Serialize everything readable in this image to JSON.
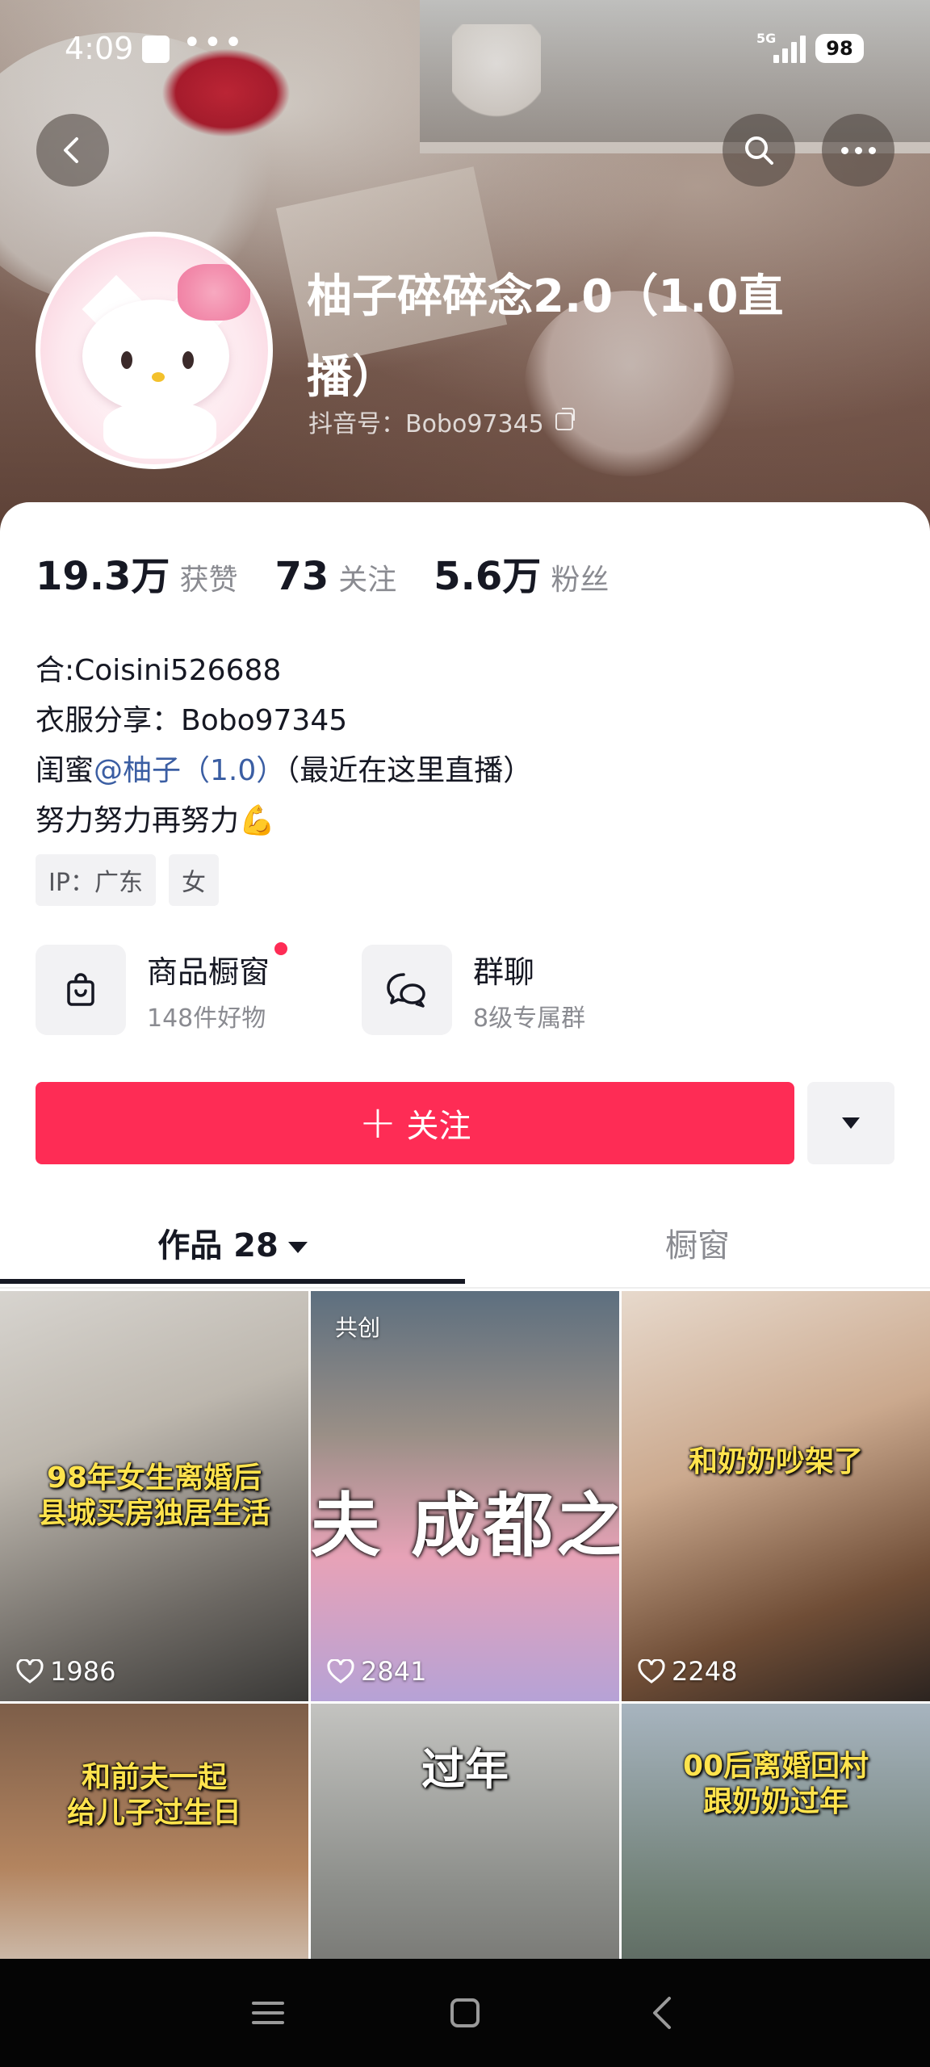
{
  "status_bar": {
    "time": "4:09",
    "dots": "•••",
    "network": "5G",
    "battery": "98"
  },
  "profile": {
    "name_line1": "柚子碎碎念2.0（1.0直",
    "name_line2": "播）",
    "douyin_id": "抖音号：Bobo97345"
  },
  "stats": [
    {
      "value": "19.3万",
      "label": "获赞"
    },
    {
      "value": "73",
      "label": "关注"
    },
    {
      "value": "5.6万",
      "label": "粉丝"
    }
  ],
  "bio": {
    "line1": "合:Coisini526688",
    "line2": "衣服分享：Bobo97345",
    "line3_prefix": "闺蜜",
    "line3_mention": "@柚子（1.0）",
    "line3_suffix": "（最近在这里直播）",
    "line4": "努力努力再努力",
    "line4_emoji": "💪"
  },
  "tags": [
    "IP：广东",
    "女"
  ],
  "entries": {
    "shop_title": "商品橱窗",
    "shop_sub": "148件好物",
    "group_title": "群聊",
    "group_sub": "8级专属群"
  },
  "actions": {
    "follow_label": "关注",
    "follow_plus": "+"
  },
  "tabs": {
    "works": "作品 28",
    "window": "橱窗"
  },
  "videos": [
    {
      "caption": "98年女生离婚后\n县城买房独居生活",
      "likes": "1986"
    },
    {
      "caption": "",
      "big_text": "夫 成都之",
      "co_tag": "共创",
      "likes": "2841"
    },
    {
      "caption": "和奶奶吵架了",
      "likes": "2248"
    },
    {
      "caption": "和前夫一起\n给儿子过生日",
      "likes": ""
    },
    {
      "caption": "过年",
      "likes": ""
    },
    {
      "caption": "00后离婚回村\n跟奶奶过年",
      "likes": ""
    }
  ],
  "colors": {
    "accent": "#fe2c55",
    "mention": "#3b5ea3",
    "caption": "#ffe34d"
  }
}
